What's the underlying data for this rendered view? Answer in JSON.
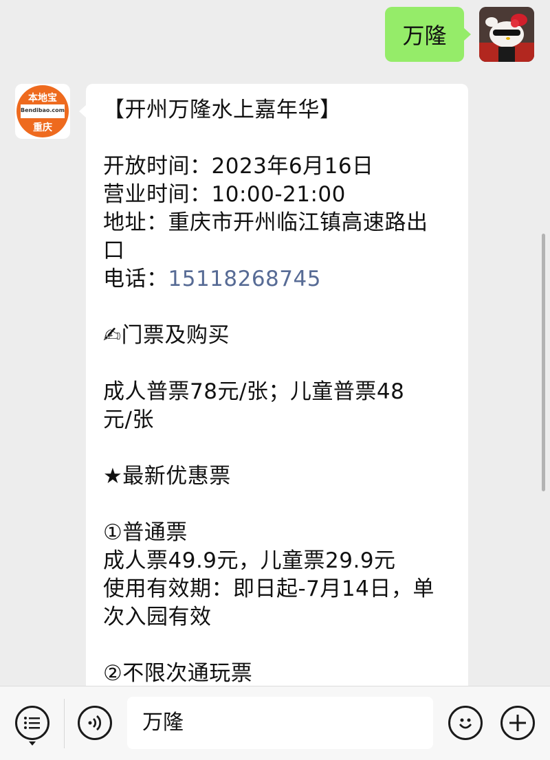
{
  "colors": {
    "background": "#ededed",
    "outgoing_bubble": "#95ec69",
    "incoming_bubble": "#ffffff",
    "link": "#576b95",
    "logo_orange": "#ee6a1e"
  },
  "outgoing_message": {
    "text": "万隆",
    "avatar_icon": "hello-kitty-avatar"
  },
  "incoming_message": {
    "avatar": {
      "logo_top": "本地宝",
      "logo_sub": "Bendibao.com",
      "logo_bottom": "重庆"
    },
    "lines": [
      "【开州万隆水上嘉年华】",
      "",
      "开放时间：2023年6月16日",
      "营业时间：10:00-21:00",
      "地址：重庆市开州临江镇高速路出",
      "口",
      "电话：15118268745",
      "",
      "✍门票及购买",
      "",
      "成人普票78元/张；儿童普票48",
      "元/张",
      "",
      "★最新优惠票",
      "",
      "①普通票",
      "成人票49.9元，儿童票29.9元",
      "使用有效期：即日起-7月14日，单",
      "次入园有效",
      "",
      "②不限次通玩票"
    ],
    "phone_label": "电话：",
    "phone_number": "15118268745"
  },
  "input_bar": {
    "menu_icon": "list-menu-icon",
    "voice_icon": "voice-icon",
    "input_value": "万隆",
    "emoji_icon": "emoji-icon",
    "plus_icon": "plus-icon"
  }
}
